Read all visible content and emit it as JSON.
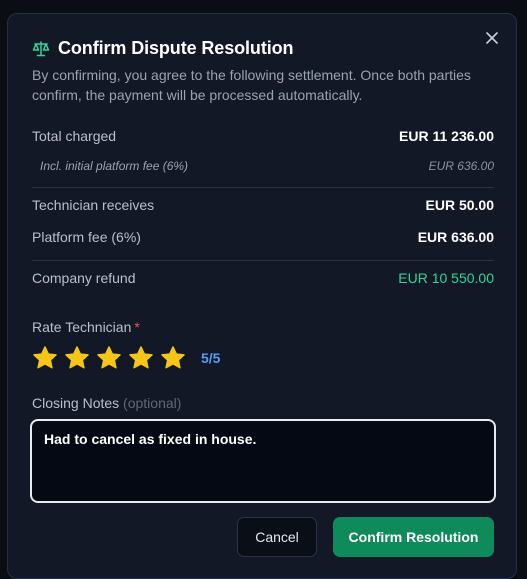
{
  "dialog": {
    "title": "Confirm Dispute Resolution",
    "subtitle": "By confirming, you agree to the following settlement. Once both parties confirm, the payment will be processed automatically."
  },
  "settlement": {
    "total_charged_label": "Total charged",
    "total_charged_value": "EUR 11 236.00",
    "initial_fee_label": "Incl. initial platform fee (6%)",
    "initial_fee_value": "EUR 636.00",
    "technician_label": "Technician receives",
    "technician_value": "EUR 50.00",
    "platform_fee_label": "Platform fee (6%)",
    "platform_fee_value": "EUR 636.00",
    "refund_label": "Company refund",
    "refund_value": "EUR 10 550.00"
  },
  "rating": {
    "label": "Rate Technician",
    "required_mark": "*",
    "value": 5,
    "max": 5,
    "display": "5/5"
  },
  "notes": {
    "label": "Closing Notes",
    "optional_hint": "(optional)",
    "value": "Had to cancel as fixed in house."
  },
  "actions": {
    "cancel_label": "Cancel",
    "confirm_label": "Confirm Resolution"
  },
  "icons": {
    "title_icon": "scale-icon",
    "close_icon": "close-icon",
    "star_icon": "star-icon"
  },
  "colors": {
    "accent_green": "#0f8a5a",
    "refund_green": "#34d399",
    "star_gold": "#f5c518",
    "rating_blue": "#5b9bf5",
    "required_red": "#f05252"
  }
}
